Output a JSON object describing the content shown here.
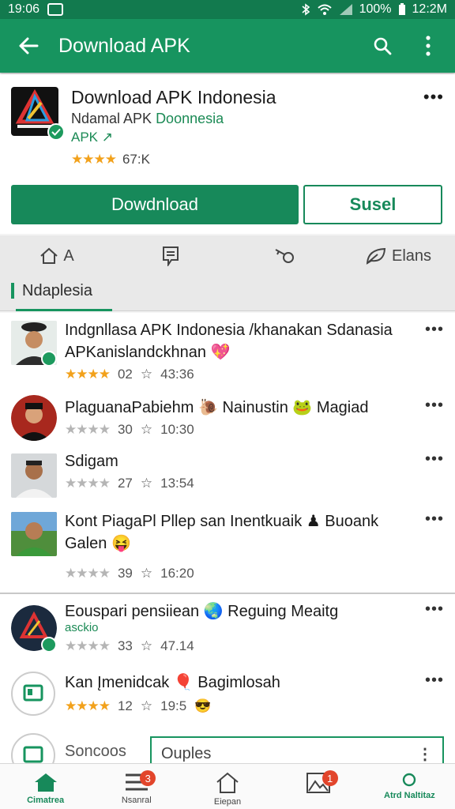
{
  "status_bar": {
    "time": "19:06",
    "battery": "100%",
    "clock": "12:2M"
  },
  "app_bar": {
    "title": "Download APK"
  },
  "app": {
    "title": "Download APK Indonesia",
    "subtitle_plain": "Ndamal APK ",
    "subtitle_green": "Doonnesia",
    "tag": "APK",
    "rating_text": "67:K",
    "stars": 4,
    "download_label": "Dowdnload",
    "secondary_label": "Susel"
  },
  "tabs": [
    {
      "label": "A",
      "icon": "home-icon"
    },
    {
      "label": "",
      "icon": "news-icon"
    },
    {
      "label": "",
      "icon": "key-icon"
    },
    {
      "label": "Elans",
      "icon": "leaf-icon"
    }
  ],
  "section": {
    "label": "Ndaplesia"
  },
  "items": [
    {
      "title": "Indgnllasa APK Indonesia /khanakan Sdanasia APKanislandckhnan",
      "emoji": "💖",
      "stars": 4,
      "count": "02",
      "time": "43:36"
    },
    {
      "title": "PlaguanaРabiehm 🐌 Nainustin 🐸 Magiad",
      "emoji": "",
      "stars": 0,
      "count": "30",
      "time": "10:30"
    },
    {
      "title": "Sdigam",
      "emoji": "",
      "stars": 0,
      "count": "27",
      "time": "13:54"
    },
    {
      "title": "Kont PiagaPl Pllep san Inentkuaik ♟ Buoank Galen",
      "emoji": "😝",
      "stars": 0,
      "count": "39",
      "time": "16:20"
    },
    {
      "title": "Eouspari pensiiean 🌏 Reguing Meaitg",
      "tag": "asckio",
      "stars": 0,
      "count": "33",
      "time": "47.14"
    },
    {
      "title": "Kan Įmenidcak 🎈 Bagimlosah",
      "stars": 4,
      "count": "12",
      "time": "19:5",
      "emoji": "😎"
    }
  ],
  "bottom_row": {
    "label": "Soncoos",
    "field_value": "Ouples"
  },
  "bottom_nav": [
    {
      "label": "Cimatrea",
      "icon": "home-icon",
      "badge": ""
    },
    {
      "label": "Nsanral",
      "icon": "list-icon",
      "badge": "3"
    },
    {
      "label": "Eiepan",
      "icon": "house-outline-icon",
      "badge": ""
    },
    {
      "label": "",
      "icon": "image-icon",
      "badge": "1"
    },
    {
      "label": "Atrd Naltitaz",
      "icon": "pin-icon",
      "badge": ""
    }
  ],
  "colors": {
    "primary": "#17945f",
    "dark": "#127a4e",
    "star": "#f2a11b",
    "badge": "#e2452b"
  }
}
